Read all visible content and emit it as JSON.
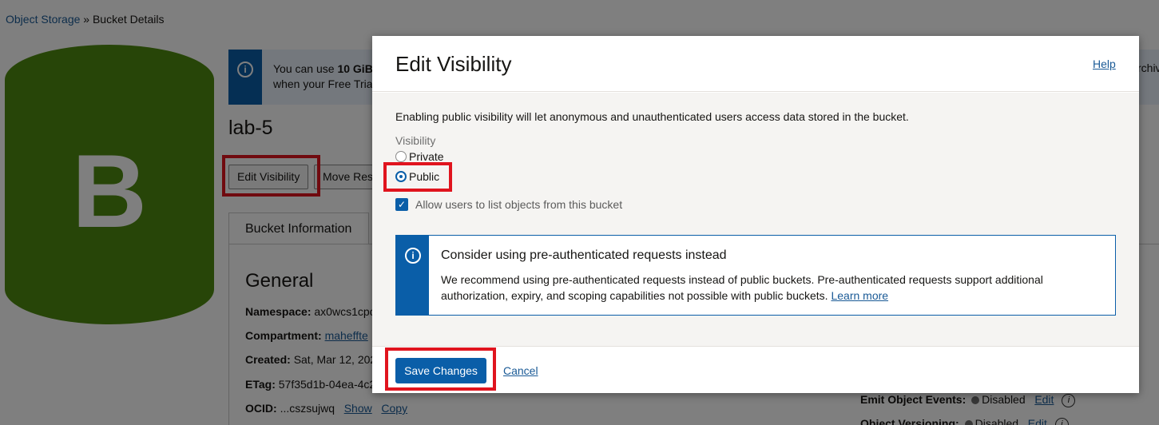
{
  "breadcrumb": {
    "root": "Object Storage",
    "separator": "»",
    "current": "Bucket Details"
  },
  "bucket": {
    "icon_letter": "B",
    "icon_color": "#4f8a10",
    "name": "lab-5",
    "banner_text": "You can use 10 GiB ... when your Free Trial",
    "banner_text_bold": "10 GiB",
    "banner_right_text": "rchivi",
    "buttons": {
      "edit_visibility": "Edit Visibility",
      "move_resource": "Move Res"
    },
    "tabs": {
      "bucket_info": "Bucket Information"
    },
    "general": {
      "title": "General",
      "namespace_label": "Namespace:",
      "namespace_value": "ax0wcs1cpc",
      "compartment_label": "Compartment:",
      "compartment_value": "maheffte",
      "created_label": "Created:",
      "created_value": "Sat, Mar 12, 202",
      "etag_label": "ETag:",
      "etag_value": "57f35d1b-04ea-4c2",
      "ocid_label": "OCID:",
      "ocid_value": "...cszsujwq",
      "ocid_show": "Show",
      "ocid_copy": "Copy"
    },
    "right": {
      "emit_label": "Emit Object Events:",
      "emit_value": "Disabled",
      "emit_edit": "Edit",
      "versioning_label": "Object Versioning:",
      "versioning_value": "Disabled",
      "versioning_edit": "Edit"
    }
  },
  "dialog": {
    "title": "Edit Visibility",
    "help": "Help",
    "description": "Enabling public visibility will let anonymous and unauthenticated users access data stored in the bucket.",
    "visibility_label": "Visibility",
    "options": [
      {
        "label": "Private",
        "selected": false
      },
      {
        "label": "Public",
        "selected": true
      }
    ],
    "allow_list_label": "Allow users to list objects from this bucket",
    "allow_list_checked": true,
    "notice": {
      "title": "Consider using pre-authenticated requests instead",
      "text": "We recommend using pre-authenticated requests instead of public buckets. Pre-authenticated requests support additional authorization, expiry, and scoping capabilities not possible with public buckets.",
      "link": "Learn more"
    },
    "save_label": "Save Changes",
    "cancel_label": "Cancel"
  },
  "colors": {
    "accent": "#0a5ea8",
    "highlight": "#e0141e",
    "link": "#1a5a96"
  }
}
